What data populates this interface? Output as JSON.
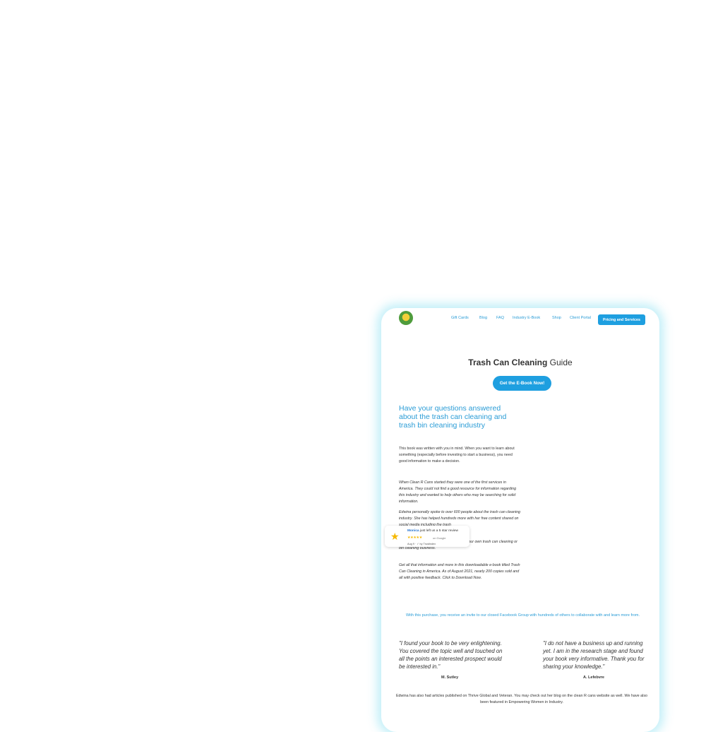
{
  "nav": {
    "links": [
      "Gift Cards",
      "Blog",
      "FAQ",
      "Industry E-Book",
      "Shop",
      "Client Portal"
    ],
    "cta": "Pricing and Services"
  },
  "hero": {
    "title_bold": "Trash Can Cleaning",
    "title_rest": " Guide",
    "button": "Get the E-Book Now!"
  },
  "section": {
    "heading": "Have your questions answered about the trash can cleaning and trash bin cleaning industry",
    "p1": "This book was written with you in mind. When you want to learn about something (especially before investing to start a business), you need good information to make a decision.",
    "p2": "When Clean R Cans started they were one of the first services in America. They could not find a good resource for information regarding this industry and wanted to help others who may be searching for solid information.",
    "p3": "Edwina personally spoke to over 600 people about the trash can cleaning industry. She has helped hundreds more with her free content shared on social media including the trash",
    "p4": "answered about what is required to start your own trash can cleaning or bin cleaning business.",
    "p5": "Get all that information and more in this downloadable e-book titled Trash Can Cleaning in America. As of August 2021, nearly 200 copies sold and all with positive feedback. Click to Download Now."
  },
  "toast": {
    "name": "Monica",
    "text": " just left us a 5 star review",
    "stars": "★★★★★",
    "on": "on Google",
    "verified": "Aug 9 · ✓ by Trustindex"
  },
  "invite": "With this purchase, you receive an invite to our closed Facebook Group with hundreds of others to collaborate with and learn more from.",
  "testimonials": [
    {
      "quote": "\"I found your book to be very enlightening. You covered the topic well and touched on all the points an interested prospect would be interested in.\"",
      "author": "M. Sutley"
    },
    {
      "quote": "\"I do not have a business up and running yet. I am in the research stage and found your book very informative. Thank you for sharing your knowledge.\"",
      "author": "A. Lefebvre"
    }
  ],
  "footer": "Edwina has also had articles published on Thrive Global and Veteran. You may check out her blog on the clean R cans website as well. We have also been featured in Empowering Women in Industry."
}
